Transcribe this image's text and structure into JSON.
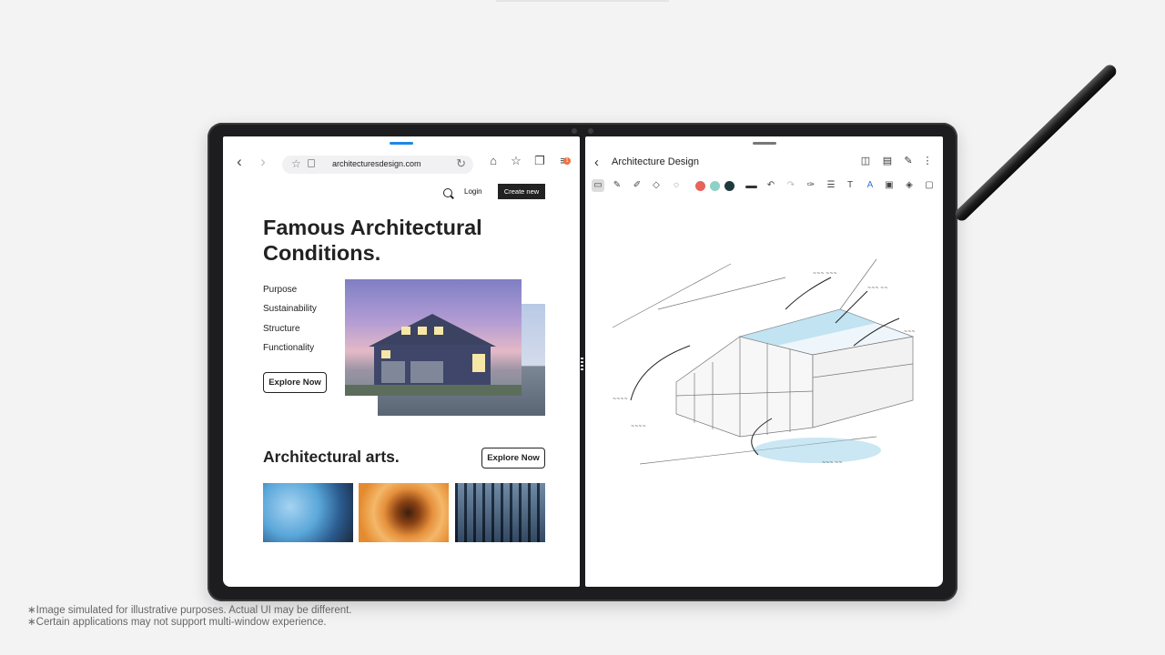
{
  "browser": {
    "url": "architecturesdesign.com",
    "tab_count_badge": "1"
  },
  "website": {
    "login": "Login",
    "create_new": "Create new",
    "hero_title": "Famous Architectural Conditions.",
    "menu": [
      "Purpose",
      "Sustainability",
      "Structure",
      "Functionality"
    ],
    "explore_label": "Explore Now",
    "section_title": "Architectural arts.",
    "section_explore_label": "Explore Now"
  },
  "notes": {
    "title": "Architecture Design",
    "pen_colors": [
      "#e8635b",
      "#8fd1c4",
      "#1f3a3f"
    ]
  },
  "disclaimer": {
    "line1": "∗Image simulated for illustrative purposes. Actual UI may be different.",
    "line2": "∗Certain applications may not support multi-window experience."
  }
}
